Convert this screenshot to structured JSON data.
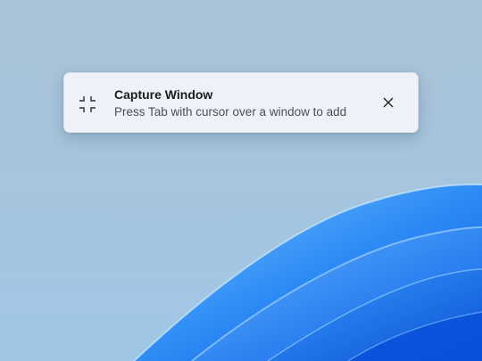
{
  "desktop": {
    "wallpaper": "windows-11-bloom-wallpaper"
  },
  "toast": {
    "icon": "capture-window-icon",
    "title": "Capture Window",
    "subtitle": "Press Tab with cursor over a window to add",
    "close_icon": "close-icon"
  }
}
